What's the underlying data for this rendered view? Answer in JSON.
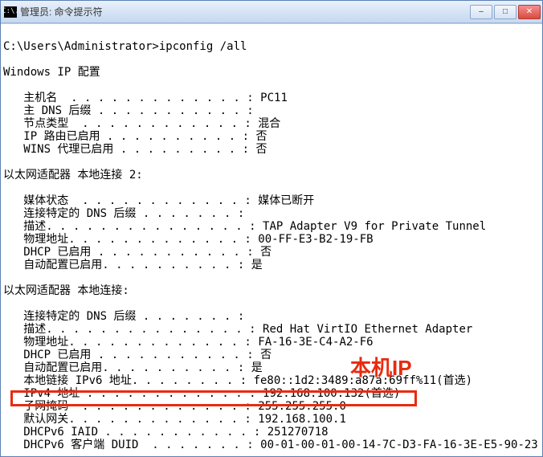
{
  "titlebar": {
    "icon_text": "C:\\.",
    "title": "管理员: 命令提示符"
  },
  "window_controls": {
    "minimize": "–",
    "maximize": "□",
    "close": "✕"
  },
  "prompt_line": "C:\\Users\\Administrator>ipconfig /all",
  "section_windows_ip": "Windows IP 配置",
  "windows_ip": {
    "hostname_label": "   主机名  . . . . . . . . . . . . . : ",
    "hostname_value": "PC11",
    "dns_suffix_label": "   主 DNS 后缀 . . . . . . . . . . . : ",
    "dns_suffix_value": "",
    "node_type_label": "   节点类型  . . . . . . . . . . . . : ",
    "node_type_value": "混合",
    "ip_routing_label": "   IP 路由已启用 . . . . . . . . . . : ",
    "ip_routing_value": "否",
    "wins_proxy_label": "   WINS 代理已启用 . . . . . . . . . : ",
    "wins_proxy_value": "否"
  },
  "section_adapter2": "以太网适配器 本地连接 2:",
  "adapter2": {
    "media_state_label": "   媒体状态  . . . . . . . . . . . . : ",
    "media_state_value": "媒体已断开",
    "dns_suffix_label": "   连接特定的 DNS 后缀 . . . . . . . : ",
    "dns_suffix_value": "",
    "desc_label": "   描述. . . . . . . . . . . . . . . : ",
    "desc_value": "TAP Adapter V9 for Private Tunnel",
    "mac_label": "   物理地址. . . . . . . . . . . . . : ",
    "mac_value": "00-FF-E3-B2-19-FB",
    "dhcp_label": "   DHCP 已启用 . . . . . . . . . . . : ",
    "dhcp_value": "否",
    "autoconf_label": "   自动配置已启用. . . . . . . . . . : ",
    "autoconf_value": "是"
  },
  "section_adapter1": "以太网适配器 本地连接:",
  "adapter1": {
    "dns_suffix_label": "   连接特定的 DNS 后缀 . . . . . . . : ",
    "dns_suffix_value": "",
    "desc_label": "   描述. . . . . . . . . . . . . . . : ",
    "desc_value": "Red Hat VirtIO Ethernet Adapter",
    "mac_label": "   物理地址. . . . . . . . . . . . . : ",
    "mac_value": "FA-16-3E-C4-A2-F6",
    "dhcp_label": "   DHCP 已启用 . . . . . . . . . . . : ",
    "dhcp_value": "否",
    "autoconf_label": "   自动配置已启用. . . . . . . . . . : ",
    "autoconf_value": "是",
    "ipv6_ll_label": "   本地链接 IPv6 地址. . . . . . . . : ",
    "ipv6_ll_value": "fe80::1d2:3489:a87a:69ff%11(首选)",
    "ipv4_label": "   IPv4 地址 . . . . . . . . . . . . : ",
    "ipv4_value": "192.168.100.132(首选)",
    "mask_label": "   子网掩码  . . . . . . . . . . . . : ",
    "mask_value": "255.255.255.0",
    "gateway_label": "   默认网关. . . . . . . . . . . . . : ",
    "gateway_value": "192.168.100.1",
    "iaid_label": "   DHCPv6 IAID . . . . . . . . . . . : ",
    "iaid_value": "251270718",
    "duid_label": "   DHCPv6 客户端 DUID  . . . . . . . : ",
    "duid_value": "00-01-00-01-00-14-7C-D3-FA-16-3E-E5-90-23"
  },
  "annotation_text": "本机IP"
}
